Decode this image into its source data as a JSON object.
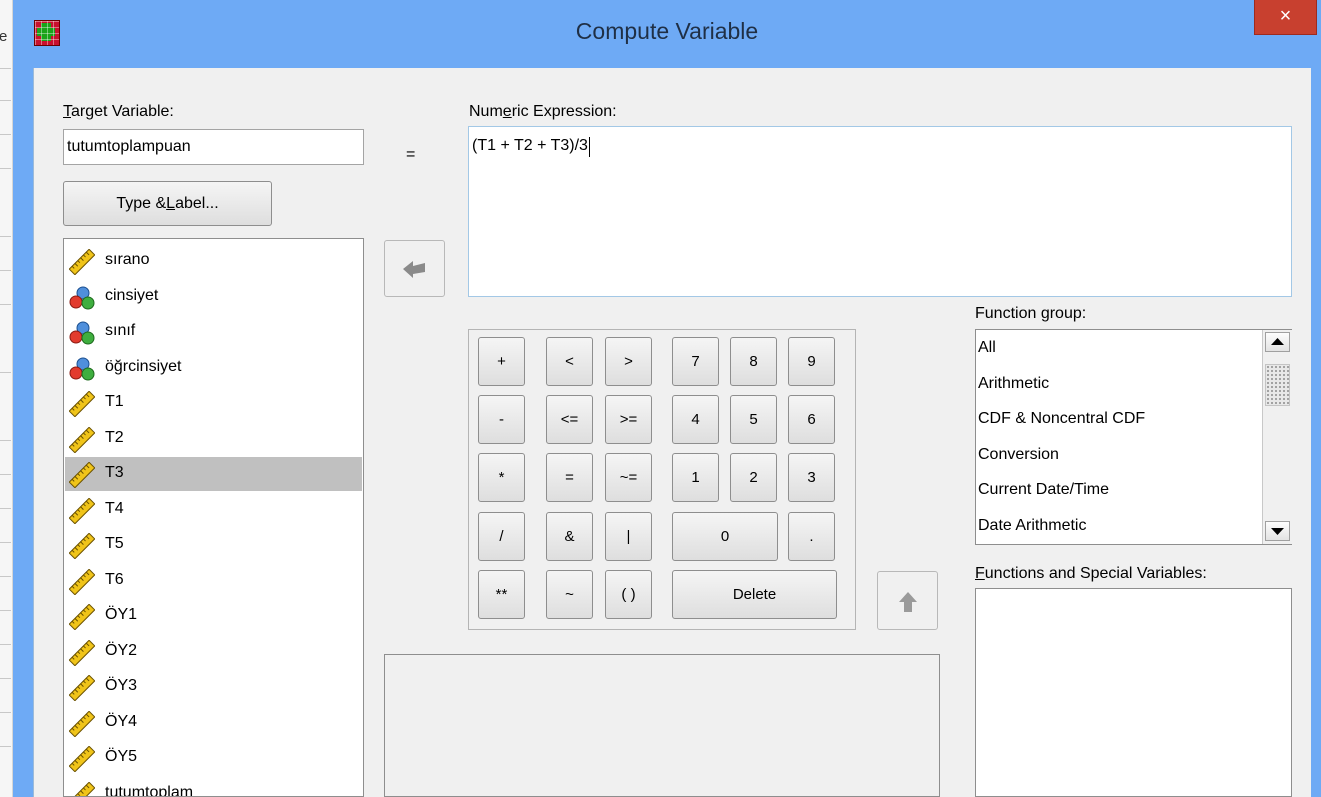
{
  "background": {
    "fragment": "e"
  },
  "window": {
    "title": "Compute Variable",
    "close_glyph": "×"
  },
  "target": {
    "label_pre": "",
    "label_ul": "T",
    "label_post": "arget Variable:",
    "value": "tutumtoplampuan"
  },
  "equals": "=",
  "expression": {
    "label_pre": "Num",
    "label_ul": "e",
    "label_post": "ric Expression:",
    "value": "(T1 + T2 + T3)/3"
  },
  "type_label_button": {
    "pre": "Type & ",
    "ul": "L",
    "post": "abel..."
  },
  "variables": [
    {
      "name": "sırano",
      "kind": "scale"
    },
    {
      "name": "cinsiyet",
      "kind": "nominal"
    },
    {
      "name": "sınıf",
      "kind": "nominal"
    },
    {
      "name": "öğrcinsiyet",
      "kind": "nominal"
    },
    {
      "name": "T1",
      "kind": "scale"
    },
    {
      "name": "T2",
      "kind": "scale"
    },
    {
      "name": "T3",
      "kind": "scale",
      "selected": true
    },
    {
      "name": "T4",
      "kind": "scale"
    },
    {
      "name": "T5",
      "kind": "scale"
    },
    {
      "name": "T6",
      "kind": "scale"
    },
    {
      "name": "ÖY1",
      "kind": "scale"
    },
    {
      "name": "ÖY2",
      "kind": "scale"
    },
    {
      "name": "ÖY3",
      "kind": "scale"
    },
    {
      "name": "ÖY4",
      "kind": "scale"
    },
    {
      "name": "ÖY5",
      "kind": "scale"
    },
    {
      "name": "tutumtoplam",
      "kind": "scale"
    }
  ],
  "keypad": {
    "operators": [
      [
        "+",
        "<",
        ">"
      ],
      [
        "-",
        "<=",
        ">="
      ],
      [
        "*",
        "=",
        "~="
      ],
      [
        "/",
        "&",
        "|"
      ],
      [
        "**",
        "~",
        "( )"
      ]
    ],
    "digits": [
      [
        "7",
        "8",
        "9"
      ],
      [
        "4",
        "5",
        "6"
      ],
      [
        "1",
        "2",
        "3"
      ]
    ],
    "zero": "0",
    "dot": ".",
    "delete": "Delete"
  },
  "function_group": {
    "label_pre": "Function ",
    "label_ul": "g",
    "label_post": "roup:",
    "items": [
      "All",
      "Arithmetic",
      "CDF & Noncentral CDF",
      "Conversion",
      "Current Date/Time",
      "Date Arithmetic"
    ]
  },
  "functions": {
    "label_pre": "",
    "label_ul": "F",
    "label_post": "unctions and Special Variables:"
  },
  "icons": {
    "app": "spss-compute-icon",
    "close": "close-icon",
    "insert_variable": "arrow-left-icon",
    "insert_function": "arrow-up-icon",
    "scale": "ruler-icon",
    "nominal": "nominal-balls-icon",
    "scroll_up": "scroll-up-icon",
    "scroll_down": "scroll-down-icon"
  },
  "colors": {
    "titlebar": "#6eaaf5",
    "close": "#c8402f",
    "selection": "#c0c0c0",
    "dialog": "#f0f0f0"
  }
}
